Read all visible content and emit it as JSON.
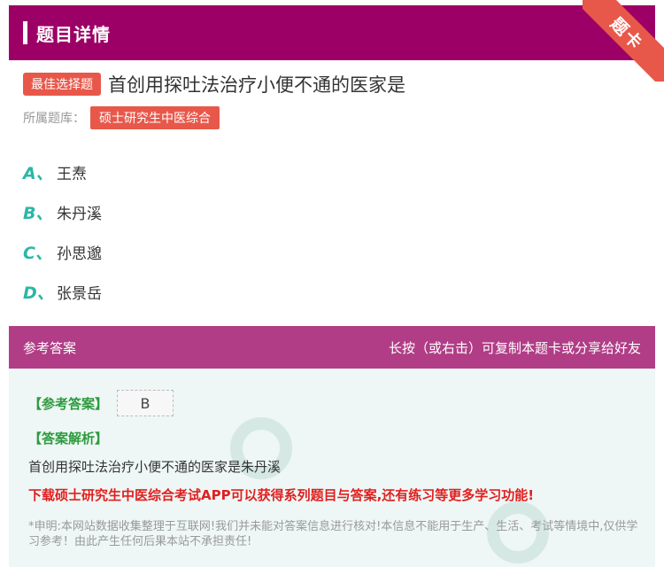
{
  "header": {
    "title": "题目详情"
  },
  "ribbon": {
    "label": "题卡"
  },
  "question": {
    "tag": "最佳选择题",
    "text": "首创用探吐法治疗小便不通的医家是",
    "library_label": "所属题库：",
    "library": "硕士研究生中医综合"
  },
  "options": [
    {
      "letter": "A、",
      "text": "王焘"
    },
    {
      "letter": "B、",
      "text": "朱丹溪"
    },
    {
      "letter": "C、",
      "text": "孙思邈"
    },
    {
      "letter": "D、",
      "text": "张景岳"
    }
  ],
  "answer_header": {
    "left": "参考答案",
    "right": "长按（或右击）可复制本题卡或分享给好友"
  },
  "answer": {
    "label": "【参考答案】",
    "value": "B",
    "analysis_label": "【答案解析】",
    "analysis_text": "首创用探吐法治疗小便不通的医家是朱丹溪",
    "promo": "下载硕士研究生中医综合考试APP可以获得系列题目与答案,还有练习等更多学习功能!",
    "disclaimer": "*申明:本网站数据收集整理于互联网!我们并未能对答案信息进行核对!本信息不能用于生产、生活、考试等情境中,仅供学习参考！由此产生任何后果本站不承担责任!"
  },
  "colors": {
    "header_bg": "#9c0066",
    "ribbon_bg": "#e8584a",
    "tag_bg": "#e8584a",
    "option_letter": "#2ab7a5",
    "answer_header_bg": "#b03d86",
    "answer_body_bg": "#eef7f5",
    "green_label": "#2e9a3f",
    "promo": "#e02020"
  }
}
